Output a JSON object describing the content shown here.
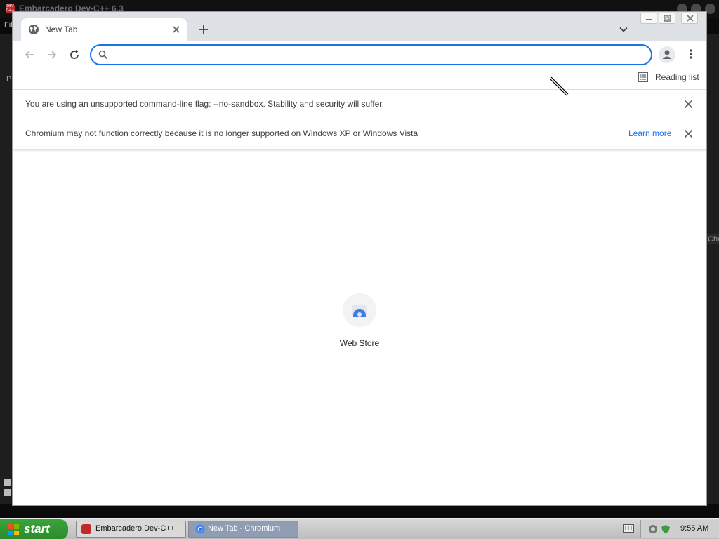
{
  "background_window": {
    "title": "Embarcadero Dev-C++ 6.3",
    "menu_fragment": "Fil",
    "side_fragment": "Cha",
    "left_fragment": "P"
  },
  "browser": {
    "tab": {
      "title": "New Tab"
    },
    "omnibox": {
      "value": ""
    },
    "bookmarks_bar": {
      "reading_list": "Reading list"
    },
    "infobars": [
      {
        "text": "You are using an unsupported command-line flag: --no-sandbox. Stability and security will suffer.",
        "link": ""
      },
      {
        "text": "Chromium may not function correctly because it is no longer supported on Windows XP or Windows Vista",
        "link": "Learn more"
      }
    ],
    "shortcuts": [
      {
        "label": "Web Store",
        "icon": "web-store-icon"
      }
    ]
  },
  "taskbar": {
    "start": "start",
    "items": [
      {
        "label": "Embarcadero Dev-C++",
        "active": false
      },
      {
        "label": "New Tab - Chromium",
        "active": true
      }
    ],
    "clock": "9:55 AM"
  },
  "colors": {
    "accent": "#1a73e8",
    "tabstrip": "#dee1e6",
    "taskbar_active": "#8f9db4",
    "start_green": "#2b8a2b"
  }
}
